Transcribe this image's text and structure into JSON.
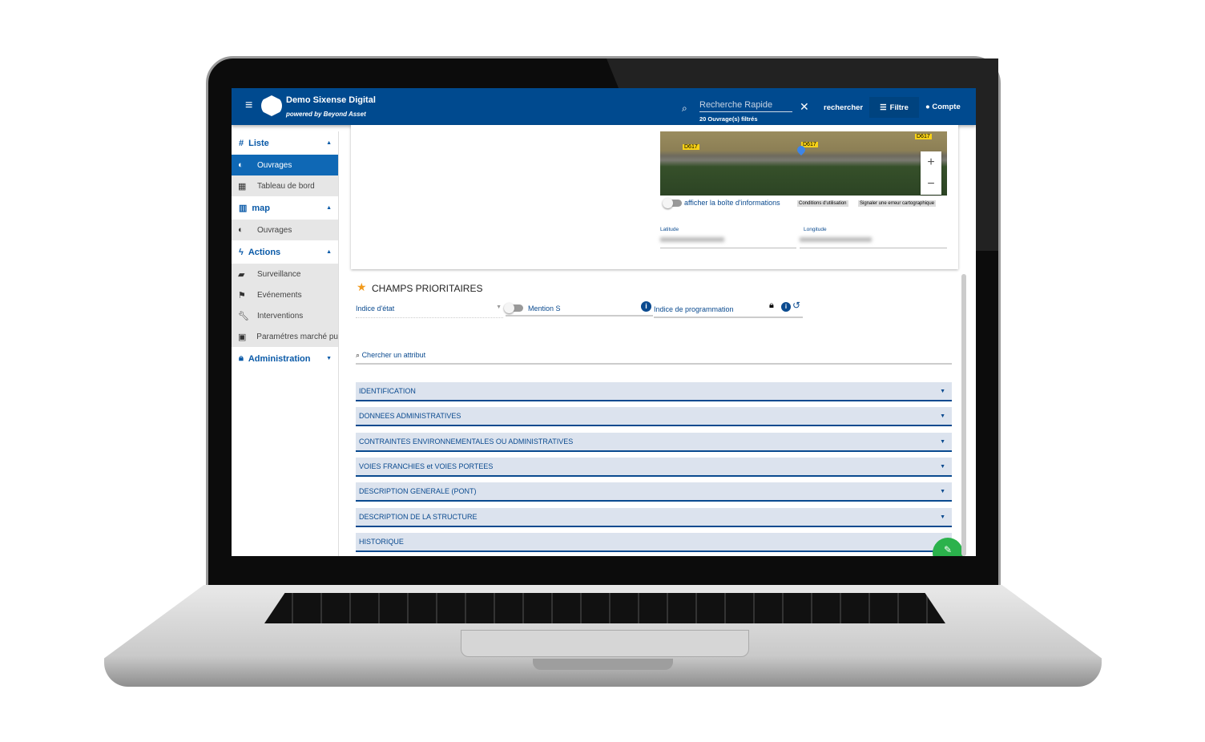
{
  "header": {
    "app_title": "Demo Sixense Digital",
    "subtitle": "powered by Beyond Asset",
    "search_placeholder": "Recherche Rapide",
    "filter_count": "20 Ouvrage(s) filtrés",
    "search_button": "rechercher",
    "filter_button": "Filtre",
    "account_button": "Compte"
  },
  "sidebar": {
    "sections": [
      {
        "label": "Liste",
        "items": [
          {
            "label": "Ouvrages"
          },
          {
            "label": "Tableau de bord"
          }
        ]
      },
      {
        "label": "map",
        "items": [
          {
            "label": "Ouvrages"
          }
        ]
      },
      {
        "label": "Actions",
        "items": [
          {
            "label": "Surveillance"
          },
          {
            "label": "Evénements"
          },
          {
            "label": "Interventions"
          },
          {
            "label": "Paramétres marché pu"
          }
        ]
      },
      {
        "label": "Administration"
      }
    ]
  },
  "map": {
    "road_labels": [
      "D617",
      "D617",
      "D617"
    ],
    "info_toggle": "afficher la boîte d'informations",
    "terms": "Conditions d'utilisation",
    "report": "Signaler une erreur cartographique",
    "zoom_in": "+",
    "zoom_out": "−",
    "latitude_label": "Latitude",
    "longitude_label": "Longitude"
  },
  "priority": {
    "title": "CHAMPS PRIORITAIRES",
    "field1": "Indice d'état",
    "field2": "Mention S",
    "field3": "Indice de programmation"
  },
  "search_attr": "Chercher un attribut",
  "sections": [
    "IDENTIFICATION",
    "DONNEES ADMINISTRATIVES",
    "CONTRAINTES ENVIRONNEMENTALES OU ADMINISTRATIVES",
    "VOIES FRANCHIES et VOIES PORTEES",
    "DESCRIPTION GENERALE (PONT)",
    "DESCRIPTION DE LA STRUCTURE",
    "HISTORIQUE"
  ],
  "colors": {
    "brand": "#004a8f",
    "active": "#0f68b5",
    "fab": "#2bb24c"
  }
}
